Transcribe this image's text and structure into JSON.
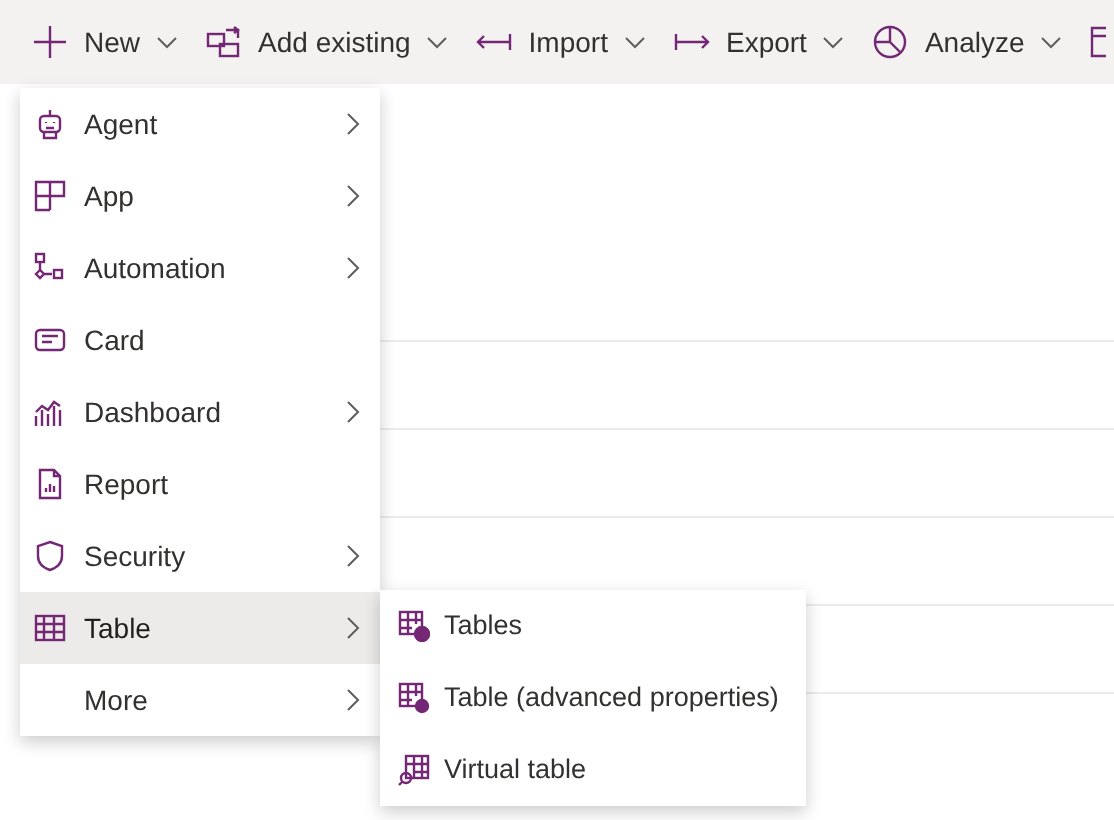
{
  "toolbar": {
    "items": [
      {
        "label": "New",
        "dropdown": true
      },
      {
        "label": "Add existing",
        "dropdown": true
      },
      {
        "label": "Import",
        "dropdown": true
      },
      {
        "label": "Export",
        "dropdown": true
      },
      {
        "label": "Analyze",
        "dropdown": true
      }
    ]
  },
  "new_menu": {
    "items": [
      {
        "label": "Agent",
        "submenu": true,
        "selected": false
      },
      {
        "label": "App",
        "submenu": true,
        "selected": false
      },
      {
        "label": "Automation",
        "submenu": true,
        "selected": false
      },
      {
        "label": "Card",
        "submenu": false,
        "selected": false
      },
      {
        "label": "Dashboard",
        "submenu": true,
        "selected": false
      },
      {
        "label": "Report",
        "submenu": false,
        "selected": false
      },
      {
        "label": "Security",
        "submenu": true,
        "selected": false
      },
      {
        "label": "Table",
        "submenu": true,
        "selected": true
      },
      {
        "label": "More",
        "submenu": true,
        "selected": false
      }
    ]
  },
  "table_submenu": {
    "items": [
      {
        "label": "Tables"
      },
      {
        "label": "Table (advanced properties)"
      },
      {
        "label": "Virtual table"
      }
    ]
  }
}
